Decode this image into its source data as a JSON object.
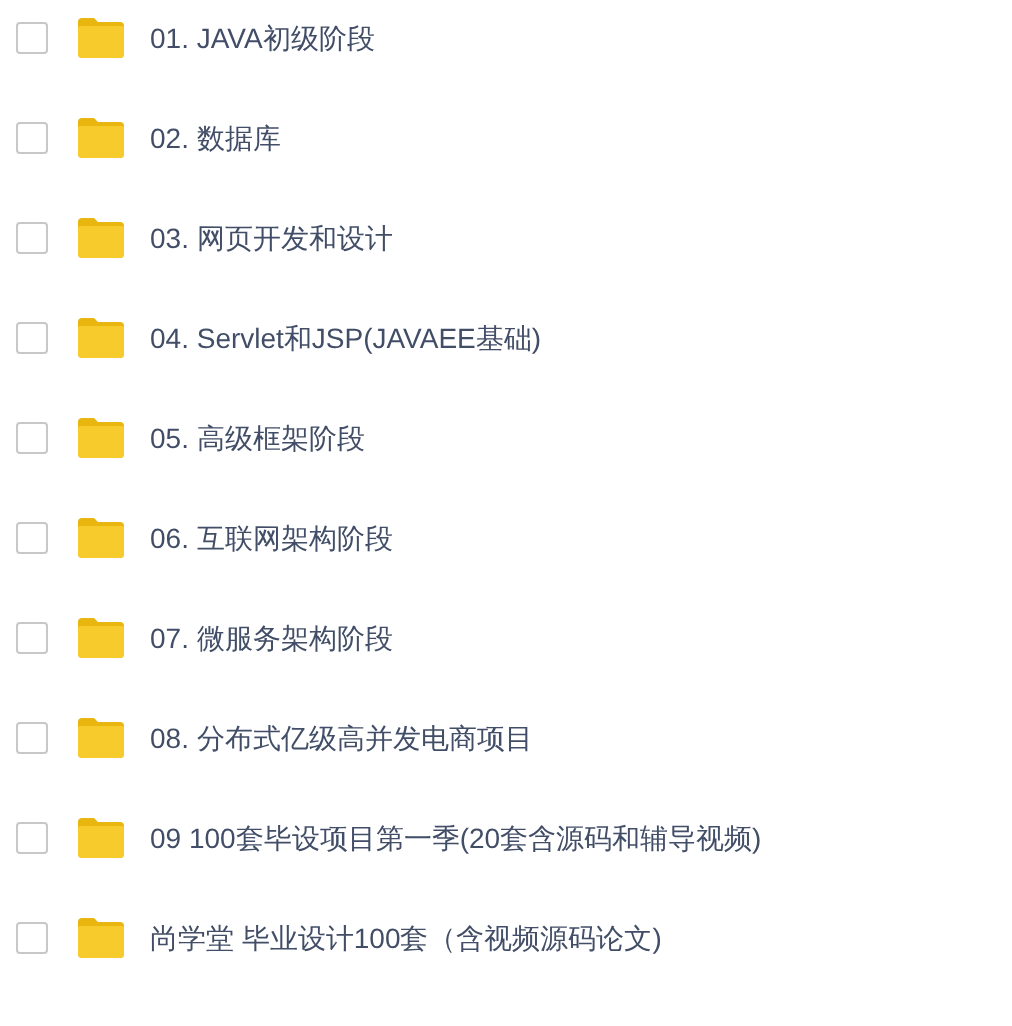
{
  "files": [
    {
      "name": "01. JAVA初级阶段",
      "checked": false
    },
    {
      "name": "02. 数据库",
      "checked": false
    },
    {
      "name": "03. 网页开发和设计",
      "checked": false
    },
    {
      "name": "04. Servlet和JSP(JAVAEE基础)",
      "checked": false
    },
    {
      "name": "05. 高级框架阶段",
      "checked": false
    },
    {
      "name": "06. 互联网架构阶段",
      "checked": false
    },
    {
      "name": "07. 微服务架构阶段",
      "checked": false
    },
    {
      "name": "08. 分布式亿级高并发电商项目",
      "checked": false
    },
    {
      "name": "09 100套毕设项目第一季(20套含源码和辅导视频)",
      "checked": false
    },
    {
      "name": "尚学堂 毕业设计100套（含视频源码论文)",
      "checked": false
    }
  ]
}
